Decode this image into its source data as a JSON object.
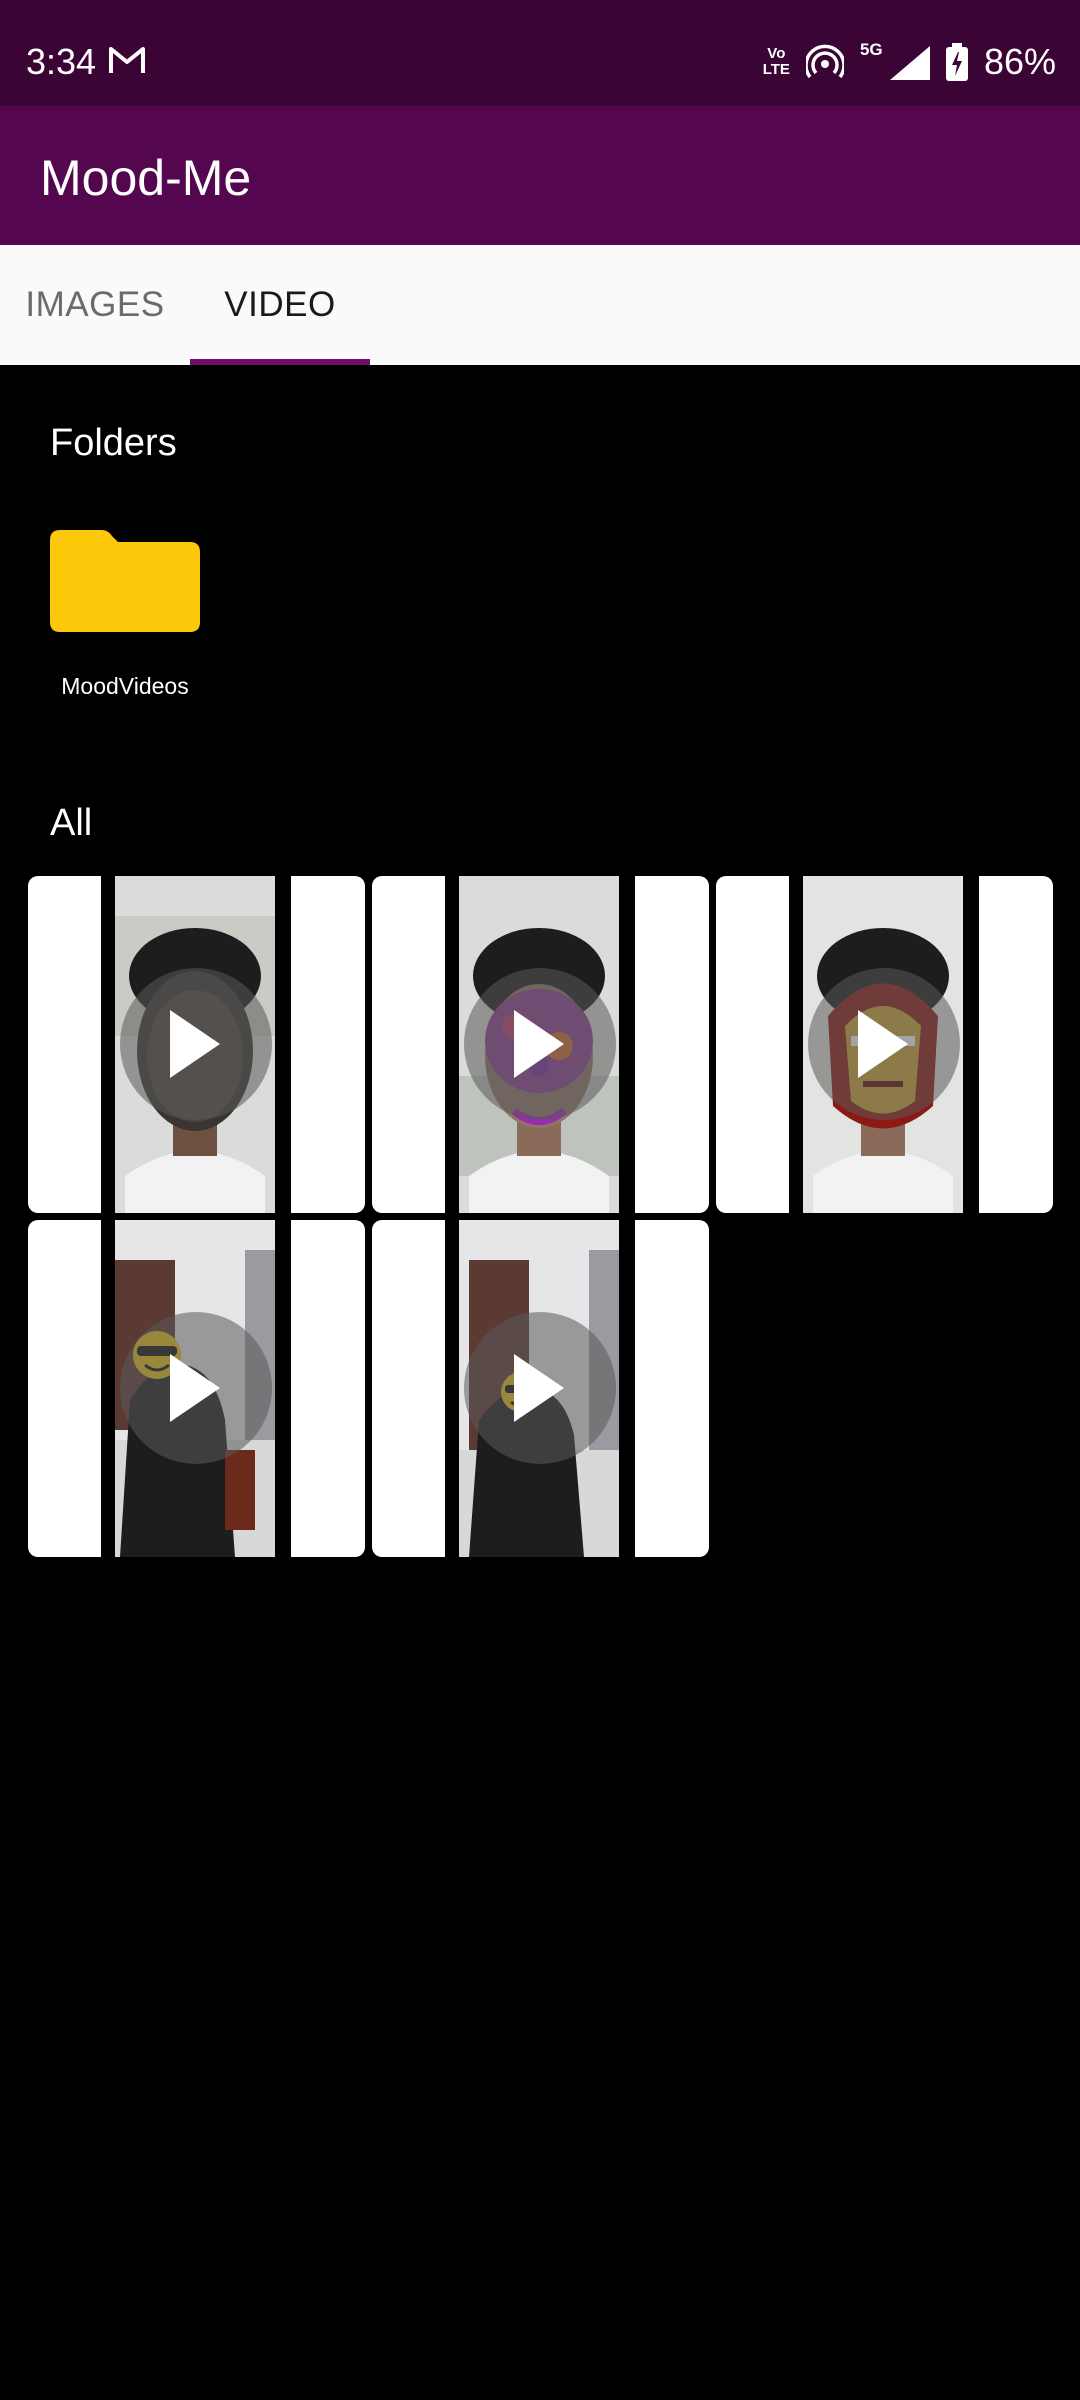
{
  "status_bar": {
    "time": "3:34",
    "volte_top": "Vo",
    "volte_bottom": "LTE",
    "network": "5G",
    "battery": "86%",
    "icons": [
      "gmail-icon",
      "volte-icon",
      "hotspot-icon",
      "signal-icon",
      "battery-icon"
    ]
  },
  "app_bar": {
    "title": "Mood-Me"
  },
  "tabs": [
    {
      "label": "IMAGES",
      "selected": false
    },
    {
      "label": "VIDEO",
      "selected": true
    }
  ],
  "folders": {
    "title": "Folders",
    "items": [
      {
        "label": "MoodVideos",
        "icon": "folder-icon",
        "color": "#fcc90a"
      }
    ]
  },
  "all": {
    "title": "All",
    "videos": [
      {
        "effect": "dark face mask",
        "icon": "play-icon"
      },
      {
        "effect": "purple patterned mask",
        "icon": "play-icon"
      },
      {
        "effect": "iron man mask",
        "icon": "play-icon"
      },
      {
        "effect": "yellow smiley with sunglasses",
        "icon": "play-icon"
      },
      {
        "effect": "yellow smiley",
        "icon": "play-icon"
      }
    ]
  },
  "colors": {
    "status_bar": "#3a0534",
    "app_bar": "#54064f",
    "tab_indicator": "#6d0f66",
    "background": "#000000"
  }
}
